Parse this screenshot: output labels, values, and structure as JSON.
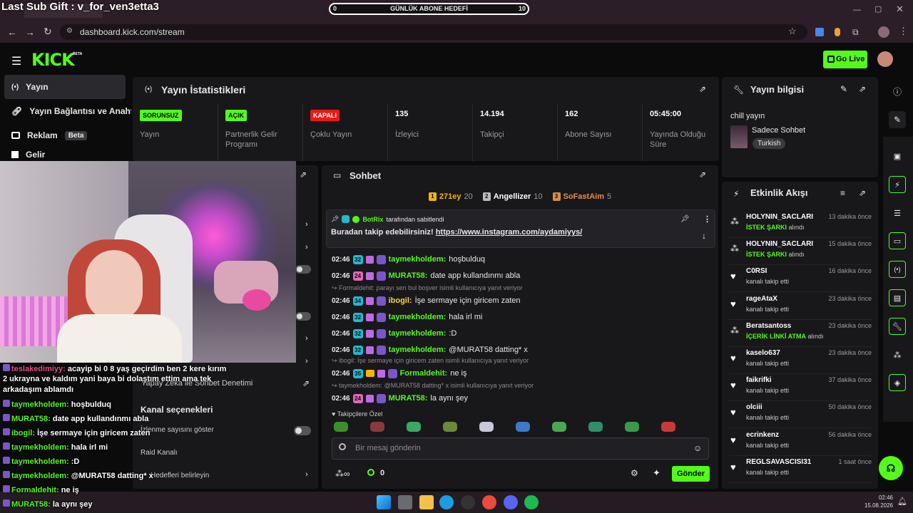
{
  "overlay": {
    "sub_gift": "Last Sub Gift : v_for_ven3etta3",
    "goal": {
      "label": "GÜNLÜK ABONE HEDEFİ",
      "current": "0",
      "target": "10",
      "progress": 0
    }
  },
  "browser": {
    "url": "dashboard.kick.com/stream"
  },
  "header": {
    "go_live": "Go Live"
  },
  "sidebar": {
    "items": [
      {
        "label": "Yayın"
      },
      {
        "label": "Yayın Bağlantısı ve Anahtar"
      },
      {
        "label": "Reklam",
        "badge": "Beta"
      },
      {
        "label": "Gelir"
      }
    ]
  },
  "stats": {
    "title": "Yayın İstatistikleri",
    "items": [
      {
        "value": "SORUNSUZ",
        "label": "Yayın",
        "color": "#53fc18"
      },
      {
        "value": "AÇIK",
        "label": "Partnerlik Gelir Programı",
        "color": "#53fc18"
      },
      {
        "value": "KAPALI",
        "label": "Çoklu Yayın",
        "color": "#e91916"
      },
      {
        "value": "135",
        "label": "İzleyici"
      },
      {
        "value": "14.194",
        "label": "Takipçi"
      },
      {
        "value": "162",
        "label": "Abone Sayısı"
      },
      {
        "value": "05:45:00",
        "label": "Yayında Olduğu Süre"
      }
    ]
  },
  "settings_panel": {
    "item_moderation": "Yapay Zeka ile Sohbet Denetimi",
    "section": "Kanal seçenekleri",
    "show_viewers": "İzlenme sayısını göster",
    "raid": "Raid Kanalı",
    "hidden_item": "Hedefleri belirleyin"
  },
  "chat": {
    "title": "Sohbet",
    "leaders": [
      {
        "name": "271ey",
        "count": "20",
        "rank": "1"
      },
      {
        "name": "Angellizer",
        "count": "10",
        "rank": "2"
      },
      {
        "name": "SoFastAim",
        "count": "5",
        "rank": "3"
      }
    ],
    "pinned": {
      "by_user": "BotRix",
      "by_suffix": "tarafından sabitlendi",
      "text": "Buradan takip edebilirsiniz! ",
      "link": "https://www.instagram.com/aydamiyys/"
    },
    "messages": [
      {
        "time": "02:46",
        "sub": "32",
        "user": "taymekholdem",
        "text": "hoşbulduq"
      },
      {
        "time": "02:46",
        "sub": "24",
        "user": "MURAT58",
        "text": "date app kullandınmı abla"
      },
      {
        "reply": "Formaldehit: parayı sen bul boşver isimli kullanıcıya yanıt veriyor"
      },
      {
        "time": "02:46",
        "sub": "34",
        "user": "ibogil",
        "text": "İşe sermaye için giricem zaten"
      },
      {
        "time": "02:46",
        "sub": "32",
        "user": "taymekholdem",
        "text": "hala irl mi"
      },
      {
        "time": "02:46",
        "sub": "32",
        "user": "taymekholdem",
        "text": ":D"
      },
      {
        "time": "02:46",
        "sub": "32",
        "user": "taymekholdem",
        "text": "@MURAT58 datting* x"
      },
      {
        "reply": "ibogil: İşe sermaye için giricem zaten isimli kullanıcıya yanıt veriyor"
      },
      {
        "time": "02:46",
        "sub": "35",
        "user": "Formaldehit",
        "text": "ne iş"
      },
      {
        "reply": "taymekholdem: @MURAT58 datting* x isimli kullanıcıya yanıt veriyor"
      },
      {
        "time": "02:46",
        "sub": "24",
        "user": "MURAT58",
        "text": "la aynı şey"
      }
    ],
    "emote_header": "Takipçilere Özel",
    "input_placeholder": "Bir mesaj gönderin",
    "points": "0",
    "send": "Gönder"
  },
  "info": {
    "title": "Yayın bilgisi",
    "stream_title": "chill yayın",
    "category": "Sadece Sohbet",
    "language": "Turkish"
  },
  "activity": {
    "title": "Etkinlik Akışı",
    "items": [
      {
        "name": "HOLYNIN_SACLARI",
        "green": "İSTEK ŞARKI",
        "sub": "alındı",
        "time": "13 dakika önce",
        "icon": "redeem-icon"
      },
      {
        "name": "HOLYNIN_SACLARI",
        "green": "İSTEK ŞARKI",
        "sub": "alındı",
        "time": "15 dakika önce",
        "icon": "redeem-icon"
      },
      {
        "name": "C0RSI",
        "sub": "kanalı takip etti",
        "time": "16 dakika önce",
        "icon": "heart-icon"
      },
      {
        "name": "rageAtaX",
        "sub": "kanalı takip etti",
        "time": "23 dakika önce",
        "icon": "heart-icon"
      },
      {
        "name": "Beratsantoss",
        "green": "İÇERİK LİNKİ ATMA",
        "sub": "alındı",
        "time": "23 dakika önce",
        "icon": "redeem-icon"
      },
      {
        "name": "kaselo637",
        "sub": "kanalı takip etti",
        "time": "23 dakika önce",
        "icon": "heart-icon"
      },
      {
        "name": "faikrifki",
        "sub": "kanalı takip etti",
        "time": "37 dakika önce",
        "icon": "heart-icon"
      },
      {
        "name": "olciii",
        "sub": "kanalı takip etti",
        "time": "50 dakika önce",
        "icon": "heart-icon"
      },
      {
        "name": "ecrinkenz",
        "sub": "kanalı takip etti",
        "time": "56 dakika önce",
        "icon": "heart-icon"
      },
      {
        "name": "REGLSAVASCISI31",
        "sub": "kanalı takip etti",
        "time": "1 saat önce",
        "icon": "heart-icon"
      }
    ]
  },
  "overlay_chat": [
    {
      "user": "teslakedimiyy",
      "text": "acayip bi 0 8 yaş geçirdim ben 2 kere kırım"
    },
    {
      "user": "",
      "text": "2 ukrayna ve kaldım yani baya bi dolaştım ettim ama tek"
    },
    {
      "user": "",
      "text": "arkadaşım ablamdı"
    },
    {
      "user": "taymekholdem",
      "text": "hoşbulduq"
    },
    {
      "user": "MURAT58",
      "text": "date app kullandınmı abla"
    },
    {
      "user": "ibogil",
      "text": "İşe sermaye için giricem zaten"
    },
    {
      "user": "taymekholdem",
      "text": "hala irl mi"
    },
    {
      "user": "taymekholdem",
      "text": ":D"
    },
    {
      "user": "taymekholdem",
      "text": "@MURAT58 datting* x"
    },
    {
      "user": "Formaldehit",
      "text": "ne iş"
    },
    {
      "user": "MURAT58",
      "text": "la aynı şey"
    }
  ],
  "taskbar": {
    "time": "02:46",
    "date": "15.08.2026"
  }
}
